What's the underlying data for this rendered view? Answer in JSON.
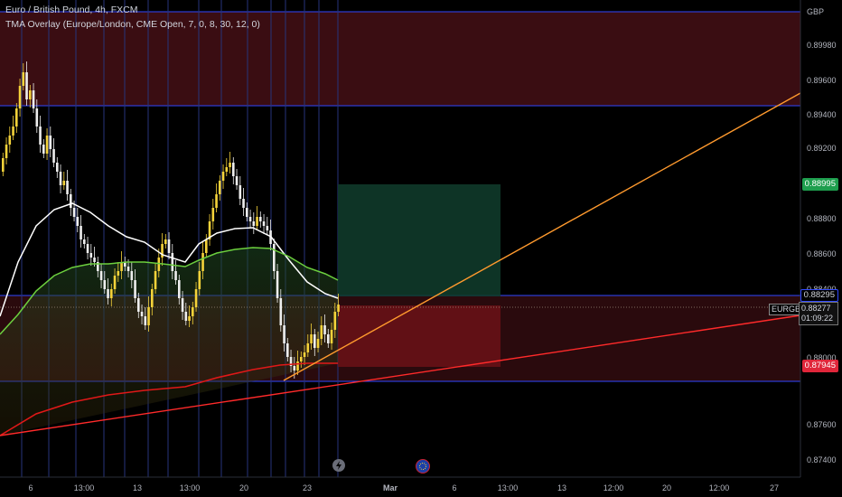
{
  "header": {
    "symbol_line": "Euro / British Pound, 4h, FXCM",
    "indicator_line": "TMA Overlay (Europe/London, CME Open, 7, 0, 8, 30, 12, 0)"
  },
  "price_axis": {
    "currency": "GBP",
    "ticks": [
      "0.89980",
      "0.89600",
      "0.89400",
      "0.89200",
      "0.89000",
      "0.88800",
      "0.88600",
      "0.88400",
      "0.88000",
      "0.87600",
      "0.87400"
    ]
  },
  "time_axis": {
    "labels": [
      "6",
      "13:00",
      "13",
      "13:00",
      "20",
      "23",
      "Mar",
      "6",
      "13:00",
      "13",
      "12:00",
      "20",
      "12:00",
      "27"
    ]
  },
  "price_tags": {
    "target": "0.88995",
    "entry": "0.88295",
    "symbol": "EURGBP",
    "last_price": "0.88277",
    "countdown": "01:09:22",
    "stop": "0.87945"
  },
  "colors": {
    "bull": "#f5d33a",
    "bear": "#eeeeee",
    "ma_fast": "#ffffff",
    "ma_slow": "#6ccf3e",
    "trend_red": "#ff2a2a",
    "trend_orange": "#ff9a2e",
    "level_line": "#3048ff",
    "target_green": "#1e9e4e",
    "stop_red": "#e0263a"
  },
  "events": {
    "lightning_icon": "lightning-icon",
    "flag_icon": "eu-flag-icon"
  }
}
